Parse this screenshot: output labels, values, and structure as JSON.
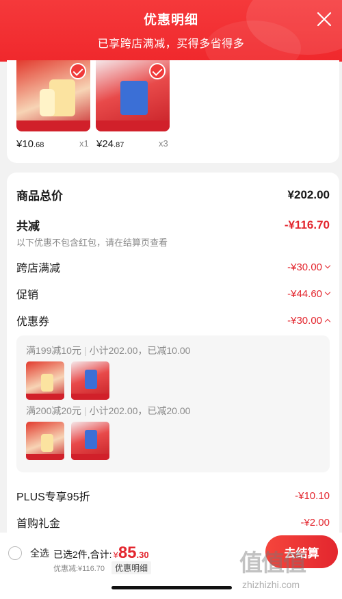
{
  "header": {
    "title": "优惠明细",
    "subtitle": "已享跨店满减，买得多省得多"
  },
  "products": [
    {
      "price_int": "¥10",
      "price_dec": ".68",
      "qty": "x1"
    },
    {
      "price_int": "¥24",
      "price_dec": ".87",
      "qty": "x3"
    }
  ],
  "summary": {
    "total_label": "商品总价",
    "total_value": "¥202.00",
    "discount_label": "共减",
    "discount_value": "-¥116.70",
    "note": "以下优惠不包含红包，请在结算页查看",
    "items": [
      {
        "label": "跨店满减",
        "value": "-¥30.00"
      },
      {
        "label": "促销",
        "value": "-¥44.60"
      },
      {
        "label": "优惠券",
        "value": "-¥30.00"
      }
    ],
    "coupons": [
      {
        "rule": "满199减10元",
        "detail": "小计202.00，已减10.00"
      },
      {
        "rule": "满200减20元",
        "detail": "小计202.00，已减20.00"
      }
    ],
    "plus_label": "PLUS专享95折",
    "plus_value": "-¥10.10",
    "first_label": "首购礼金",
    "first_value": "-¥2.00"
  },
  "footer": {
    "select_all": "全选",
    "selected": "已选2件,合计:",
    "currency": "¥",
    "amount_int": "85",
    "amount_dec": ".30",
    "discount_text": "优惠减:¥116.70",
    "detail_link": "优惠明细",
    "settle": "去结算"
  },
  "watermark": {
    "main": "值值值",
    "url": "zhizhizhi.com"
  },
  "colors": {
    "accent": "#e3262e",
    "header": "#f0282c"
  }
}
